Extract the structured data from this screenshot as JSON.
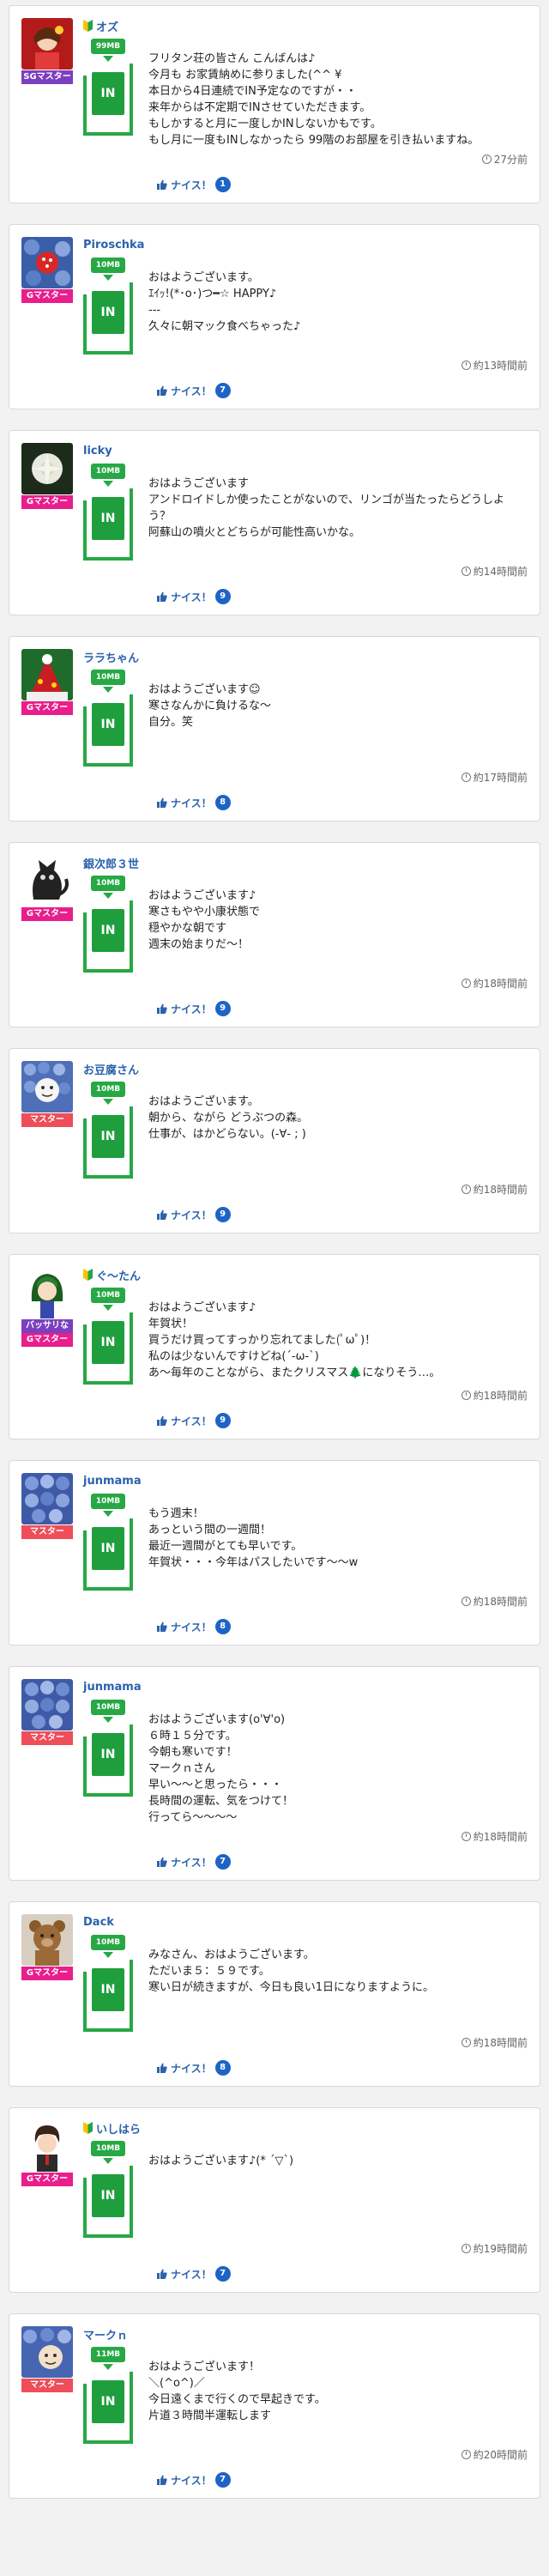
{
  "nice_label": "ナイス！",
  "posts": [
    {
      "name": "オズ",
      "beginner": true,
      "rank": "SGマスター",
      "rank_class": "sg",
      "mb": "99MB",
      "in": "IN",
      "message": "フリタン荘の皆さん こんばんは♪\n今月も お家賃納めに参りました(^^ ¥\n本日から4日連続でIN予定なのですが・・\n来年からは不定期でINさせていただきます。\nもしかすると月に一度しかINしないかもです。\nもし月に一度もINしなかったら 99階のお部屋を引き払いますね。",
      "time": "27分前",
      "nice": "1",
      "avatar": "red"
    },
    {
      "name": "Piroschka",
      "beginner": false,
      "rank": "Gマスター",
      "rank_class": "g",
      "mb": "10MB",
      "in": "IN",
      "message": "おはようございます。\nｴｲｯ!(*･o･)つ━☆ HAPPY♪\n---\n久々に朝マック食べちゃった♪",
      "time": "約13時間前",
      "nice": "7",
      "avatar": "berry"
    },
    {
      "name": "licky",
      "beginner": false,
      "rank": "Gマスター",
      "rank_class": "g",
      "mb": "10MB",
      "in": "IN",
      "message": "おはようございます\nアンドロイドしか使ったことがないので、リンゴが当たったらどうしよう？\n阿蘇山の噴火とどちらが可能性高いかな。",
      "time": "約14時間前",
      "nice": "9",
      "avatar": "flower"
    },
    {
      "name": "ララちゃん",
      "beginner": false,
      "rank": "Gマスター",
      "rank_class": "g",
      "mb": "10MB",
      "in": "IN",
      "message": "おはようございます☺\n寒さなんかに負けるな〜\n自分。笑",
      "time": "約17時間前",
      "nice": "8",
      "avatar": "xmas"
    },
    {
      "name": "銀次郎３世",
      "beginner": false,
      "rank": "Gマスター",
      "rank_class": "g",
      "mb": "10MB",
      "in": "IN",
      "message": "おはようございます♪\n寒さもやや小康状態で\n穏やかな朝です\n週末の始まりだ〜！",
      "time": "約18時間前",
      "nice": "9",
      "avatar": "cat"
    },
    {
      "name": "お豆腐さん",
      "beginner": false,
      "rank": "マスター",
      "rank_class": "m",
      "mb": "10MB",
      "in": "IN",
      "message": "おはようございます。\n朝から、ながら どうぶつの森。\n仕事が、はかどらない。(-∀- ; )",
      "time": "約18時間前",
      "nice": "9",
      "avatar": "hydrangea"
    },
    {
      "name": "ぐ〜たん",
      "beginner": true,
      "rank": "バッサリな",
      "rank2": "Gマスター",
      "rank_class": "g",
      "mb": "10MB",
      "in": "IN",
      "message": "おはようございます♪\n年賀状！\n買うだけ買ってすっかり忘れてました(ﾟωﾟ)！\n私のは少ないんですけどね(´-ω-`)\nあ〜毎年のことながら、またクリスマス🌲になりそう…。",
      "time": "約18時間前",
      "nice": "9",
      "avatar": "girl"
    },
    {
      "name": "junmama",
      "beginner": false,
      "rank": "マスター",
      "rank_class": "m",
      "mb": "10MB",
      "in": "IN",
      "message": "もう週末！\nあっという間の一週間！\n最近一週間がとても早いです。\n年賀状・・・今年はパスしたいです〜〜w",
      "time": "約18時間前",
      "nice": "8",
      "avatar": "hydrangea2"
    },
    {
      "name": "junmama",
      "beginner": false,
      "rank": "マスター",
      "rank_class": "m",
      "mb": "10MB",
      "in": "IN",
      "message": "おはようございます(o'∀'o)\n６時１５分です。\n今朝も寒いです！\nマークｎさん\n早い〜〜と思ったら・・・\n長時間の運転、気をつけて！\n行ってら〜〜〜〜",
      "time": "約18時間前",
      "nice": "7",
      "avatar": "hydrangea2"
    },
    {
      "name": "Dack",
      "beginner": false,
      "rank": "Gマスター",
      "rank_class": "g",
      "mb": "10MB",
      "in": "IN",
      "message": "みなさん、おはようございます。\nただいま５：５９です。\n寒い日が続きますが、今日も良い1日になりますように。",
      "time": "約18時間前",
      "nice": "8",
      "avatar": "bear"
    },
    {
      "name": "いしはら",
      "beginner": true,
      "rank": "Gマスター",
      "rank_class": "g",
      "mb": "10MB",
      "in": "IN",
      "message": "おはようございます♪(* ´▽`)",
      "time": "約19時間前",
      "nice": "7",
      "avatar": "man"
    },
    {
      "name": "マークｎ",
      "beginner": false,
      "rank": "マスター",
      "rank_class": "m",
      "mb": "11MB",
      "in": "IN",
      "message": "おはようございます！\n＼(^o^)／\n今日遠くまで行くので早起きです。\n片道３時間半運転します",
      "time": "約20時間前",
      "nice": "7",
      "avatar": "hydrangea3"
    }
  ]
}
